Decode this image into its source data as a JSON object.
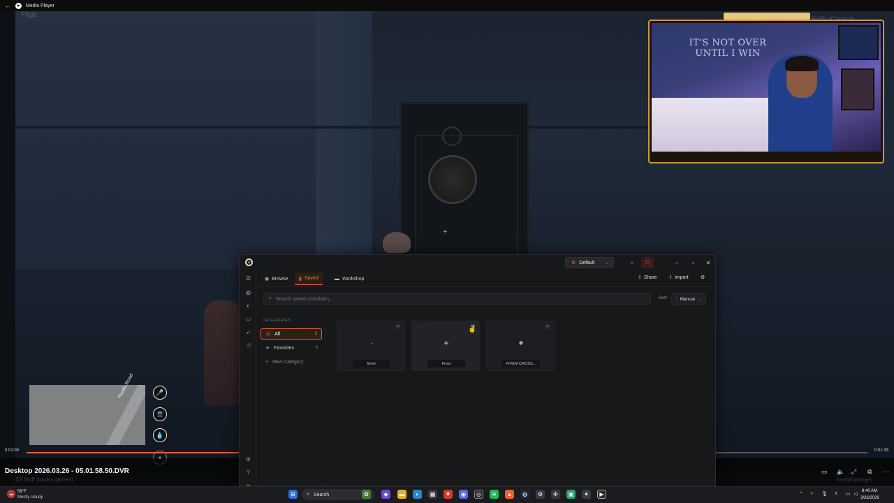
{
  "media_player": {
    "title": "Media Player",
    "file_title": "Desktop 2026.03.26 - 05.01.58.50.DVR",
    "file_subtitle": "Z3 Stuff (bucks games)",
    "time_current": "0:01:00",
    "time_total": "0:01:33",
    "progress": 0.255,
    "mode_label": "Normal (Range)",
    "scene_corner_text": "Ffrps",
    "watermark": "LinkM (6.3095) (Canary)"
  },
  "webcam": {
    "wall_text": "IT'S NOT OVER UNTIL I WIN"
  },
  "minimap": {
    "road_label": "Hualla Road"
  },
  "app": {
    "profile": "Default",
    "tabs": [
      {
        "label": "Browse",
        "icon": "compass-icon"
      },
      {
        "label": "Saved",
        "icon": "bookmark-icon"
      },
      {
        "label": "Workshop",
        "icon": "folder-icon"
      }
    ],
    "share_label": "Share",
    "import_label": "Import",
    "search_placeholder": "Search saved crosshairs...",
    "sort_label": "Sort:",
    "sort_value": "Manual",
    "categories_header": "CATEGORIES",
    "categories": [
      {
        "label": "All",
        "count": "3"
      },
      {
        "label": "Favorites",
        "count": "0"
      }
    ],
    "new_category_label": "New Category",
    "crosshairs": [
      {
        "name": "fivem",
        "glyph": "·"
      },
      {
        "name": "Frost",
        "glyph": "+"
      },
      {
        "name": "FIVEM CROSS...",
        "glyph": "+"
      }
    ],
    "accent": "#e8622d"
  },
  "taskbar": {
    "weather_temp": "59°F",
    "weather_desc": "Mostly cloudy",
    "search_label": "Search",
    "clock_time": "8:40 AM",
    "clock_date": "3/26/2026"
  }
}
